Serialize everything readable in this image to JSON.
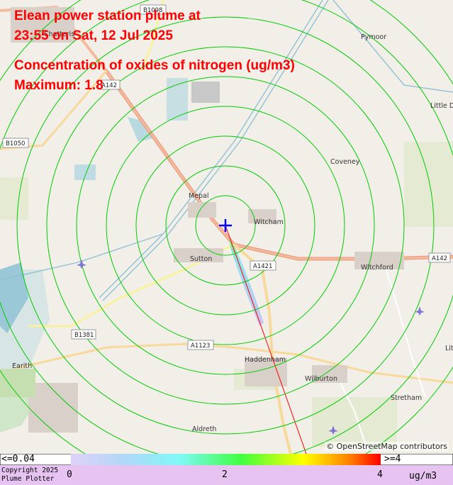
{
  "title": {
    "line1": "Elean power station plume at",
    "line2": "23:55 on Sat, 12 Jul 2025",
    "line3": "Concentration of oxides of nitrogen (ug/m3)",
    "line4": "Maximum: 1.8"
  },
  "attribution": "© OpenStreetMap contributors",
  "places": [
    {
      "name": "Mepal"
    },
    {
      "name": "Witcham"
    },
    {
      "name": "Sutton"
    },
    {
      "name": "Witchford"
    },
    {
      "name": "Coveney"
    },
    {
      "name": "Pymoor"
    },
    {
      "name": "Little D"
    },
    {
      "name": "Haddenham"
    },
    {
      "name": "Wilburton"
    },
    {
      "name": "Stretham"
    },
    {
      "name": "Aldreth"
    },
    {
      "name": "Earith"
    },
    {
      "name": "Chatteris"
    },
    {
      "name": "Litt"
    }
  ],
  "roads": [
    "B1098",
    "B1050",
    "A142",
    "A142",
    "A1421",
    "B1381",
    "A1123"
  ],
  "colors": {
    "title": "#ff0000",
    "rings": "#00cc00",
    "marker": "#0000ff",
    "plume_line": "#ff0000",
    "scale_bg": "#e6c3f0"
  },
  "colorbar": {
    "min_label": "<=0.04",
    "max_label": ">=4",
    "ticks": [
      "0",
      "2",
      "4"
    ],
    "unit": "ug/m3",
    "copyright_line1": "Copyright 2025",
    "copyright_line2": "Plume Plotter"
  },
  "plume": {
    "source_marker": "cross-icon",
    "ring_count": 9
  }
}
